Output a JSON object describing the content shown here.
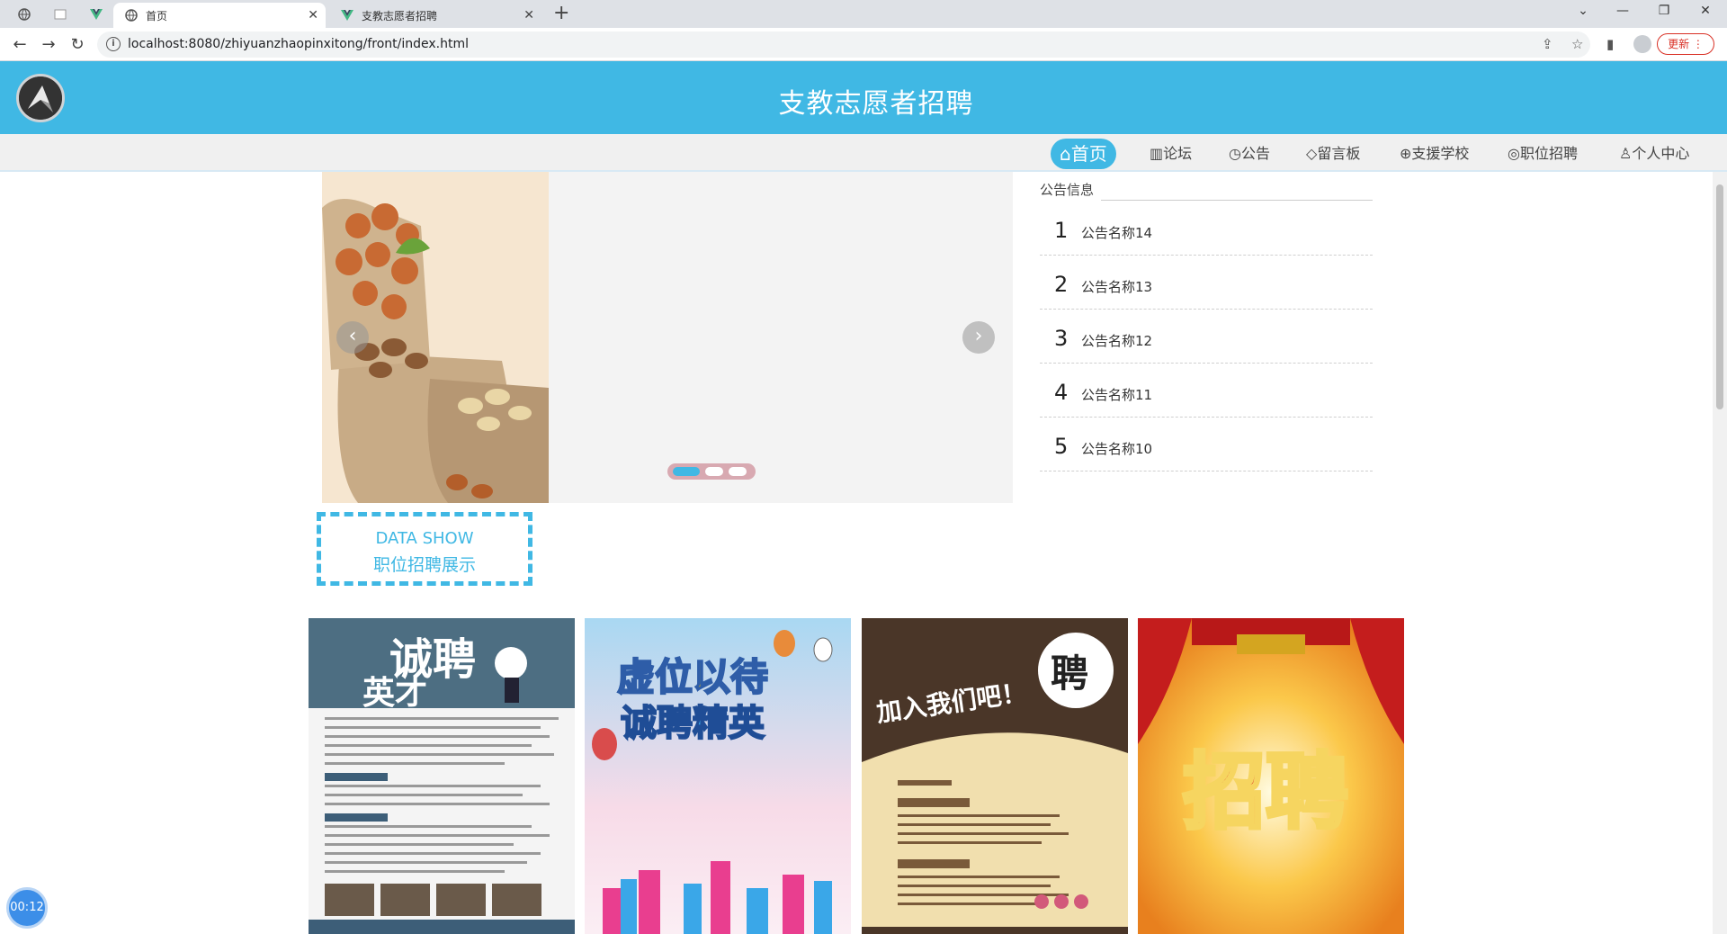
{
  "browser": {
    "tabs": [
      {
        "label": "首页",
        "active": true
      },
      {
        "label": "支教志愿者招聘",
        "active": false
      }
    ],
    "url": "localhost:8080/zhiyuanzhaopinxitong/front/index.html",
    "update_label": "更新",
    "new_tab_label": "+"
  },
  "site": {
    "title": "支教志愿者招聘"
  },
  "nav": {
    "items": [
      {
        "icon": "home-icon",
        "label": "首页",
        "active": true
      },
      {
        "icon": "forum-icon",
        "label": "论坛"
      },
      {
        "icon": "notice-icon",
        "label": "公告"
      },
      {
        "icon": "tag-icon",
        "label": "留言板"
      },
      {
        "icon": "globe-icon",
        "label": "支援学校"
      },
      {
        "icon": "target-icon",
        "label": "职位招聘"
      },
      {
        "icon": "user-icon",
        "label": "个人中心"
      }
    ]
  },
  "carousel": {
    "prev_label": "‹",
    "next_label": "›",
    "dot_count": 3,
    "active_dot": 0
  },
  "notices": {
    "heading": "公告信息",
    "items": [
      {
        "num": "1",
        "title": "公告名称14"
      },
      {
        "num": "2",
        "title": "公告名称13"
      },
      {
        "num": "3",
        "title": "公告名称12"
      },
      {
        "num": "4",
        "title": "公告名称11"
      },
      {
        "num": "5",
        "title": "公告名称10"
      }
    ]
  },
  "data_show": {
    "en": "DATA SHOW",
    "cn": "职位招聘展示"
  },
  "posters": [
    {
      "headline": "诚聘",
      "sub": "英才"
    },
    {
      "headline": "虚位以待",
      "sub": "诚聘精英"
    },
    {
      "headline": "加入我们吧！",
      "badge": "聘"
    },
    {
      "headline": "招聘"
    }
  ],
  "timer": "00:12",
  "colors": {
    "primary": "#40b8e4",
    "nav_bg": "#f0f0f0"
  }
}
